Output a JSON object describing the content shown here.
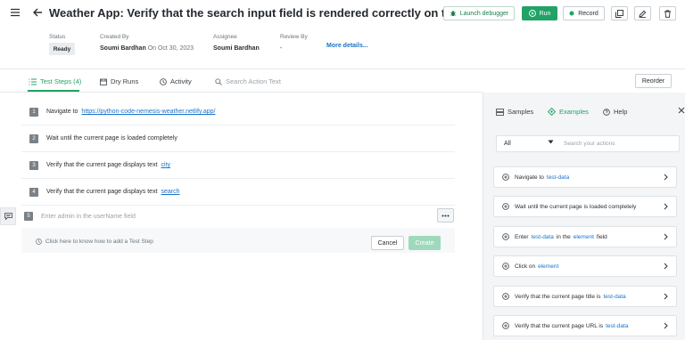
{
  "header": {
    "title": "Weather App: Verify that the search input field is rendered correctly on the page",
    "buttons": {
      "launch_debugger": "Launch debugger",
      "run": "Run",
      "record": "Record"
    }
  },
  "meta": {
    "status_label": "Status",
    "status_value": "Ready",
    "created_by_label": "Created By",
    "created_by_name": "Soumi Bardhan",
    "created_on": "On Oct 30, 2023",
    "assignee_label": "Assignee",
    "assignee_name": "Soumi Bardhan",
    "review_by_label": "Review By",
    "review_by_value": "-",
    "more_details": "More details..."
  },
  "tabs": [
    {
      "label": "Test Steps (4)",
      "active": true
    },
    {
      "label": "Dry Runs",
      "active": false
    },
    {
      "label": "Activity",
      "active": false
    }
  ],
  "search_action_placeholder": "Search Action Text",
  "reorder_label": "Reorder",
  "steps": [
    {
      "num": "1",
      "text": "Navigate to",
      "link": "https://python-code-nemesis-weather.netlify.app/"
    },
    {
      "num": "2",
      "text": "Wait until the current page is loaded completely"
    },
    {
      "num": "3",
      "text": "Verify that the current page displays text",
      "data": "city"
    },
    {
      "num": "4",
      "text": "Verify that the current page displays text",
      "data": "search"
    }
  ],
  "new_step": {
    "num": "5",
    "placeholder": "Enter admin in the userName field",
    "help": "Click here to know how to add a Test Step",
    "cancel": "Cancel",
    "create": "Create"
  },
  "right_panel": {
    "tabs": [
      {
        "label": "Samples",
        "active": false
      },
      {
        "label": "Examples",
        "active": true
      },
      {
        "label": "Help",
        "active": false
      }
    ],
    "filter_selected": "All",
    "search_placeholder": "Search your actions",
    "examples": [
      {
        "before": "Navigate to",
        "data": "test-data"
      },
      {
        "before": "Wait until the current page is loaded completely"
      },
      {
        "before": "Enter",
        "data": "test-data",
        "mid": "in the",
        "element": "element",
        "after": "field"
      },
      {
        "before": "Click on",
        "element": "element"
      },
      {
        "before": "Verify that the current page title is",
        "data": "test-data"
      },
      {
        "before": "Verify that the current page URL is",
        "data": "test-data"
      }
    ]
  },
  "colors": {
    "accent": "#21a366",
    "link": "#1a73c9"
  }
}
